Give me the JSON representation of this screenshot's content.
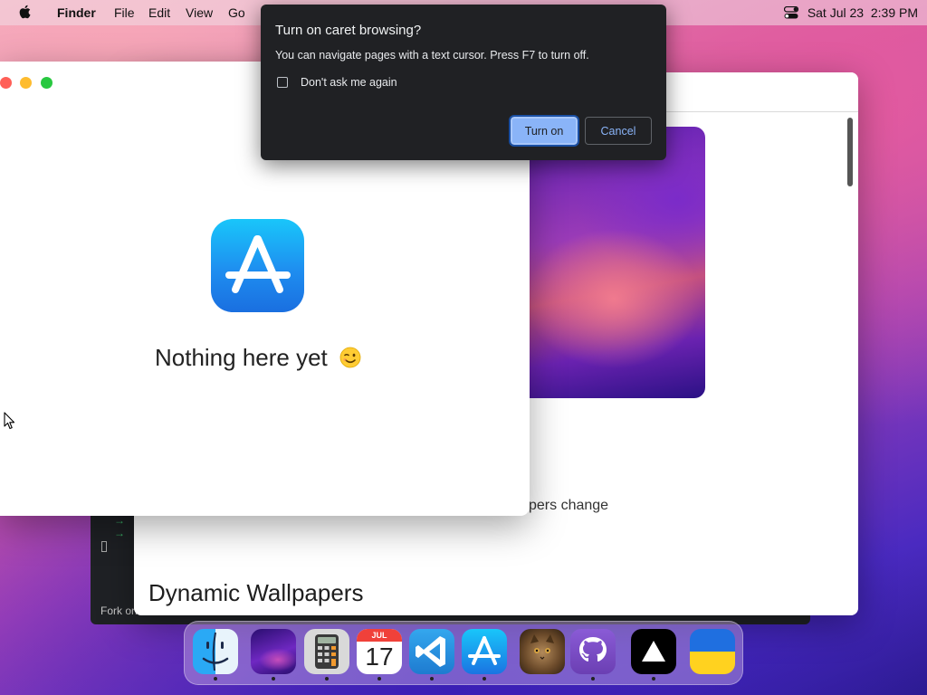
{
  "menubar": {
    "app_name": "Finder",
    "items": [
      "File",
      "Edit",
      "View",
      "Go"
    ],
    "datetime": "Sat Jul 23  2:39 PM"
  },
  "dialog": {
    "title": "Turn on caret browsing?",
    "body": "You can navigate pages with a text cursor. Press F7 to turn off.",
    "checkbox_label": "Don't ask me again",
    "checkbox_checked": false,
    "ok_label": "Turn on",
    "cancel_label": "Cancel"
  },
  "app_store_window": {
    "empty_message": "Nothing here yet",
    "emoji_icon": "winking-face-icon"
  },
  "wallpapers_window": {
    "caption": "pers change",
    "title": "Dynamic Wallpapers"
  },
  "terminal_window": {
    "footer_text": "Fork on"
  },
  "dock": {
    "items": [
      {
        "name": "finder-icon",
        "running": true
      },
      {
        "name": "wallpaper-app-icon",
        "running": true
      },
      {
        "name": "calculator-icon",
        "running": true
      },
      {
        "name": "calendar-icon",
        "running": true,
        "month": "JUL",
        "day": "17"
      },
      {
        "name": "vscode-icon",
        "running": true
      },
      {
        "name": "app-store-icon",
        "running": true
      },
      {
        "name": "cat-photo-app-icon",
        "running": false
      },
      {
        "name": "github-icon",
        "running": true
      },
      {
        "name": "vercel-triangle-icon",
        "running": true
      },
      {
        "name": "ukraine-flag-icon",
        "running": false
      }
    ]
  },
  "colors": {
    "dialog_bg": "#202124",
    "dialog_accent": "#8ab4f8",
    "traffic_red": "#ff5f57",
    "traffic_yellow": "#febc2e",
    "traffic_green": "#28c840"
  }
}
